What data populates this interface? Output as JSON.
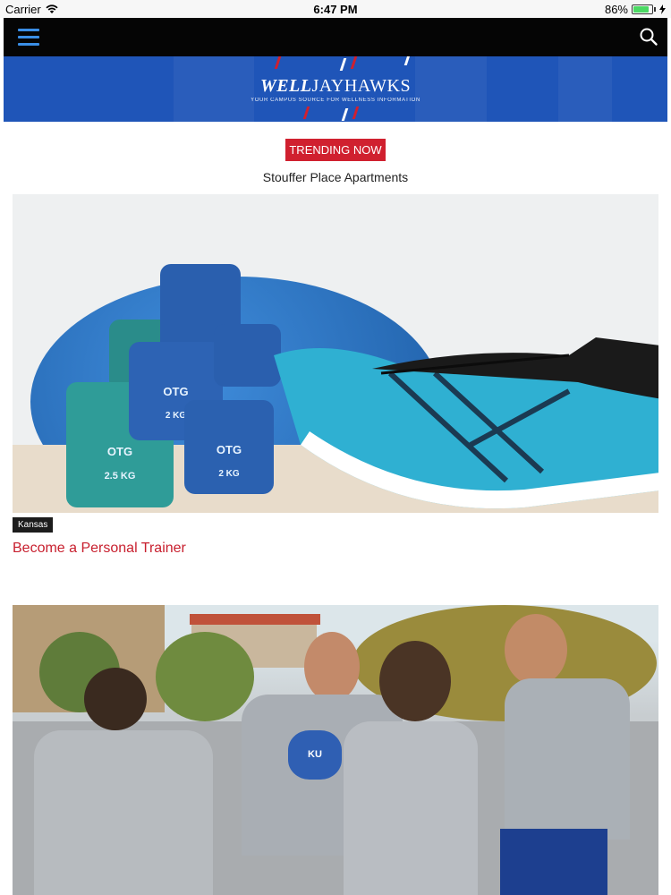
{
  "status_bar": {
    "carrier": "Carrier",
    "time": "6:47 PM",
    "battery": "86%",
    "battery_level": 0.86
  },
  "nav": {
    "menu_icon": "hamburger-menu-icon",
    "search_icon": "search-icon"
  },
  "banner": {
    "title_bold": "WELL",
    "title_rest": "JAYHAWKS",
    "tagline": "YOUR CAMPUS SOURCE FOR WELLNESS INFORMATION"
  },
  "trending": {
    "badge": "TRENDING NOW",
    "headline": "Stouffer Place Apartments"
  },
  "articles": [
    {
      "tag": "Kansas",
      "title": "Become a Personal Trainer",
      "dumbbell_labels": [
        "2 KG",
        "2 KG",
        "2.5 KG"
      ],
      "dumbbell_brand": "OTG"
    },
    {
      "shirt_label": "KU"
    }
  ],
  "colors": {
    "accent_red": "#d0202f",
    "banner_blue": "#1f55b8",
    "nav_black": "#050505",
    "menu_blue": "#3a8ee6"
  }
}
